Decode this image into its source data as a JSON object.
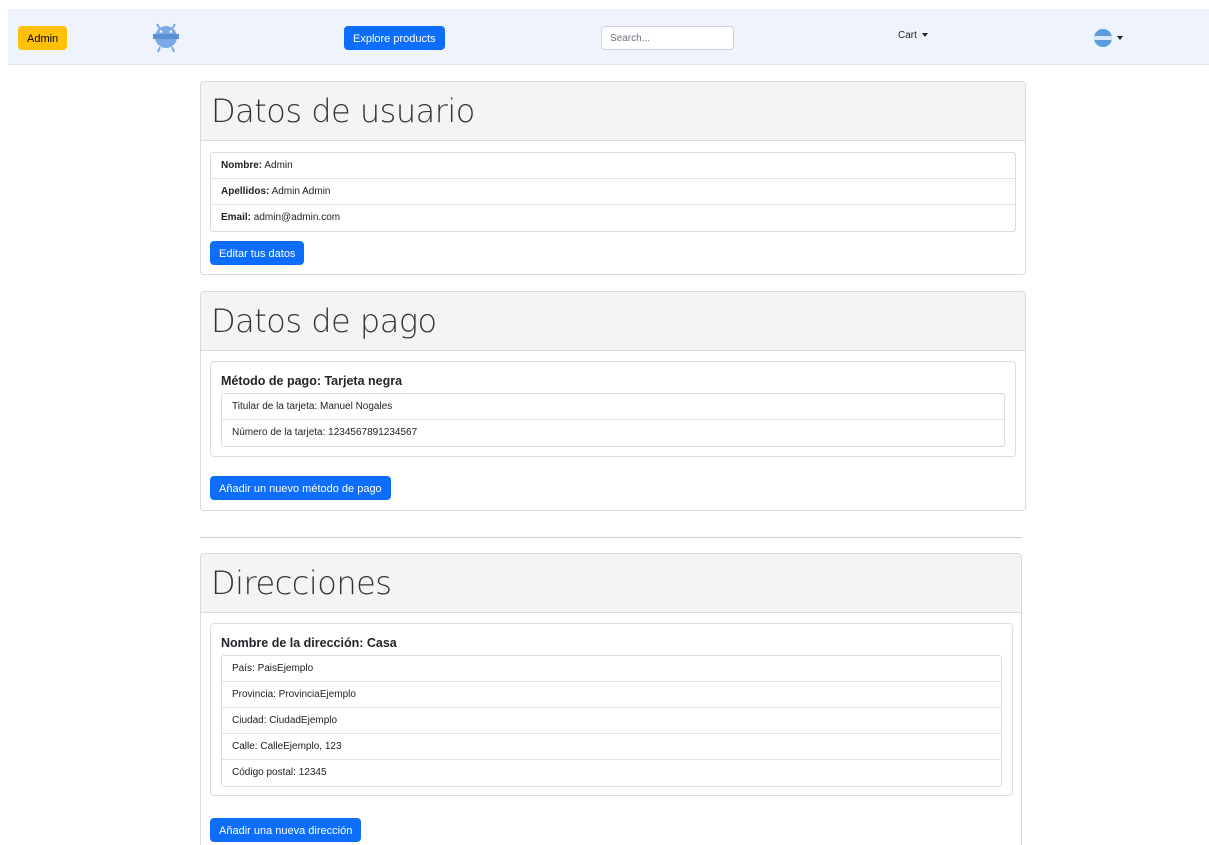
{
  "nav": {
    "admin_label": "Admin",
    "explore_label": "Explore products",
    "search_placeholder": "Search...",
    "cart_label": "Cart",
    "logo_icon": "android-robot-icon",
    "user_icon": "user-avatar-icon"
  },
  "user": {
    "title": "Datos de usuario",
    "fields": [
      {
        "label": "Nombre:",
        "value": " Admin"
      },
      {
        "label": "Apellidos:",
        "value": " Admin Admin"
      },
      {
        "label": "Email:",
        "value": " admin@admin.com"
      }
    ],
    "edit_label": "Editar tus datos"
  },
  "payment": {
    "title": "Datos de pago",
    "method_title": "Método de pago: Tarjeta negra",
    "fields": [
      "Titular de la tarjeta: Manuel Nogales",
      "Número de la tarjeta: 1234567891234567"
    ],
    "add_label": "Añadir un nuevo método de pago"
  },
  "addresses": {
    "title": "Direcciones",
    "address_title": "Nombre de la dirección: Casa",
    "fields": [
      "País: PaisEjemplo",
      "Provincia: ProvinciaEjemplo",
      "Ciudad: CiudadEjemplo",
      "Calle: CalleEjemplo, 123",
      "Código postal: 12345"
    ],
    "add_label": "Añadir una nueva dirección"
  },
  "colors": {
    "primary": "#0d6efd",
    "warning": "#ffc107",
    "navbar_bg": "#eef3fc",
    "card_header_bg": "#f4f4f4"
  }
}
